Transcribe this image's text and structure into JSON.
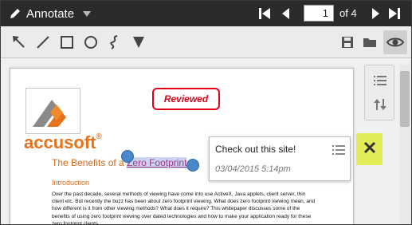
{
  "topbar": {
    "mode_label": "Annotate",
    "page_current": "1",
    "page_of": "of 4",
    "icons": [
      "pencil-icon",
      "chevron-down-icon",
      "first-page-icon",
      "prev-page-icon",
      "next-page-icon",
      "last-page-icon"
    ]
  },
  "toolbar": {
    "tools": [
      "arrow-icon",
      "line-icon",
      "rectangle-icon",
      "ellipse-icon",
      "freehand-icon",
      "text-triangle-icon"
    ],
    "right_tools": [
      "save-icon",
      "folder-icon",
      "eye-icon"
    ]
  },
  "document": {
    "logo": {
      "text_main": "accusoft",
      "text_suffix": "®"
    },
    "stamp_label": "Reviewed",
    "title_before": "The Benefits of a ",
    "title_highlight": "Zero Footprint",
    "title_after": " e",
    "intro_heading": "Introduction",
    "body_text": "Over the past decade, several methods of viewing have come into use   ActiveX, Java applets, client server, thin client etc. But recently the buzz has been about zero footprint viewing. What does zero footprint viewing mean, and how different is it from other viewing methods?  What does it require? This whitepaper discusses some of the benefits of using zero footprint viewing over dated technologies and how to make your application ready for these zero footprint clients."
  },
  "comment": {
    "text": "Check out this site!",
    "date": "03/04/2015 5:14pm"
  },
  "side_panel": {
    "icons": [
      "list-icon",
      "sort-icon"
    ]
  },
  "colors": {
    "topbar_bg": "#2b2b2b",
    "toolbar_bg": "#ebebeb",
    "stamp_red": "#e0001a",
    "title_orange": "#d4691a",
    "handle_blue": "#4a86c8",
    "close_bg": "#e2ec57"
  }
}
